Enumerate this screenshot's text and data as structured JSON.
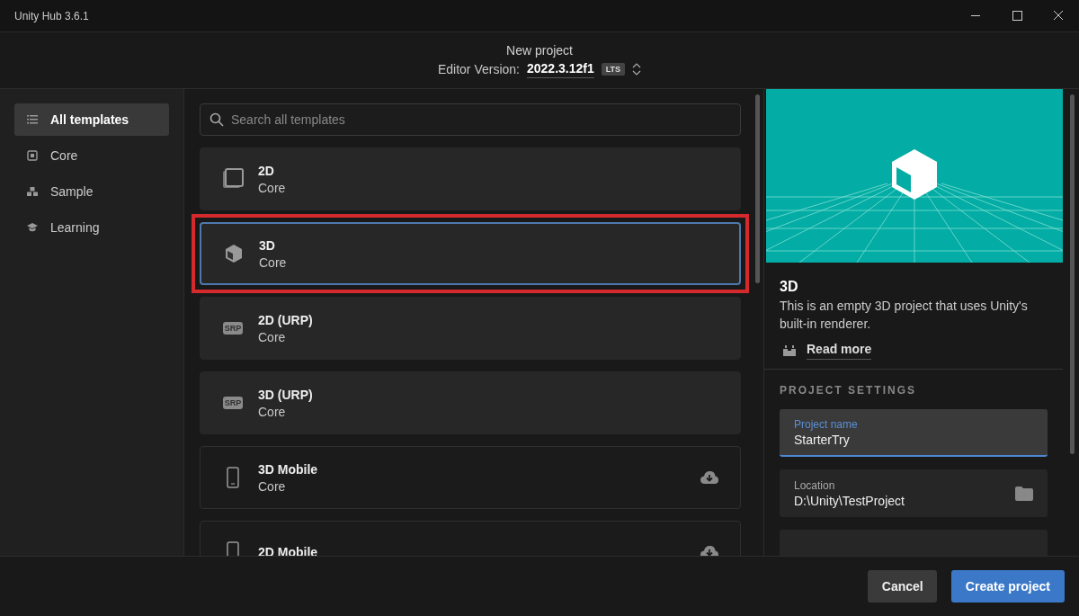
{
  "window": {
    "title": "Unity Hub 3.6.1"
  },
  "header": {
    "title": "New project",
    "version_label": "Editor Version:",
    "version": "2022.3.12f1",
    "version_badge": "LTS"
  },
  "sidebar": {
    "items": [
      {
        "label": "All templates",
        "kind": "list",
        "selected": true
      },
      {
        "label": "Core",
        "kind": "core",
        "selected": false
      },
      {
        "label": "Sample",
        "kind": "sample",
        "selected": false
      },
      {
        "label": "Learning",
        "kind": "learning",
        "selected": false
      }
    ]
  },
  "search": {
    "placeholder": "Search all templates"
  },
  "templates": [
    {
      "name": "2D",
      "category": "Core",
      "kind": "square",
      "installed": true,
      "selected": false,
      "highlighted": false
    },
    {
      "name": "3D",
      "category": "Core",
      "kind": "cube",
      "installed": true,
      "selected": true,
      "highlighted": true
    },
    {
      "name": "2D (URP)",
      "category": "Core",
      "kind": "srp",
      "icon_text": "SRP",
      "installed": true,
      "selected": false,
      "highlighted": false
    },
    {
      "name": "3D (URP)",
      "category": "Core",
      "kind": "srp",
      "icon_text": "SRP",
      "installed": true,
      "selected": false,
      "highlighted": false
    },
    {
      "name": "3D Mobile",
      "category": "Core",
      "kind": "phone",
      "installed": false,
      "selected": false,
      "highlighted": false
    },
    {
      "name": "2D Mobile",
      "kind": "phone",
      "installed": false,
      "selected": false,
      "highlighted": false
    }
  ],
  "details": {
    "title": "3D",
    "description": "This is an empty 3D project that uses Unity's built-in renderer.",
    "link": "Read more"
  },
  "settings": {
    "heading": "PROJECT SETTINGS",
    "fields": [
      {
        "label": "Project name",
        "value": "StarterTry",
        "focused": true,
        "kind": "text"
      },
      {
        "label": "Location",
        "value": "D:\\Unity\\TestProject",
        "focused": false,
        "kind": "folder"
      },
      {
        "kind": "empty",
        "focused": false
      }
    ]
  },
  "buttons": [
    {
      "label": "Cancel",
      "kind": "secondary"
    },
    {
      "label": "Create project",
      "kind": "primary"
    }
  ]
}
